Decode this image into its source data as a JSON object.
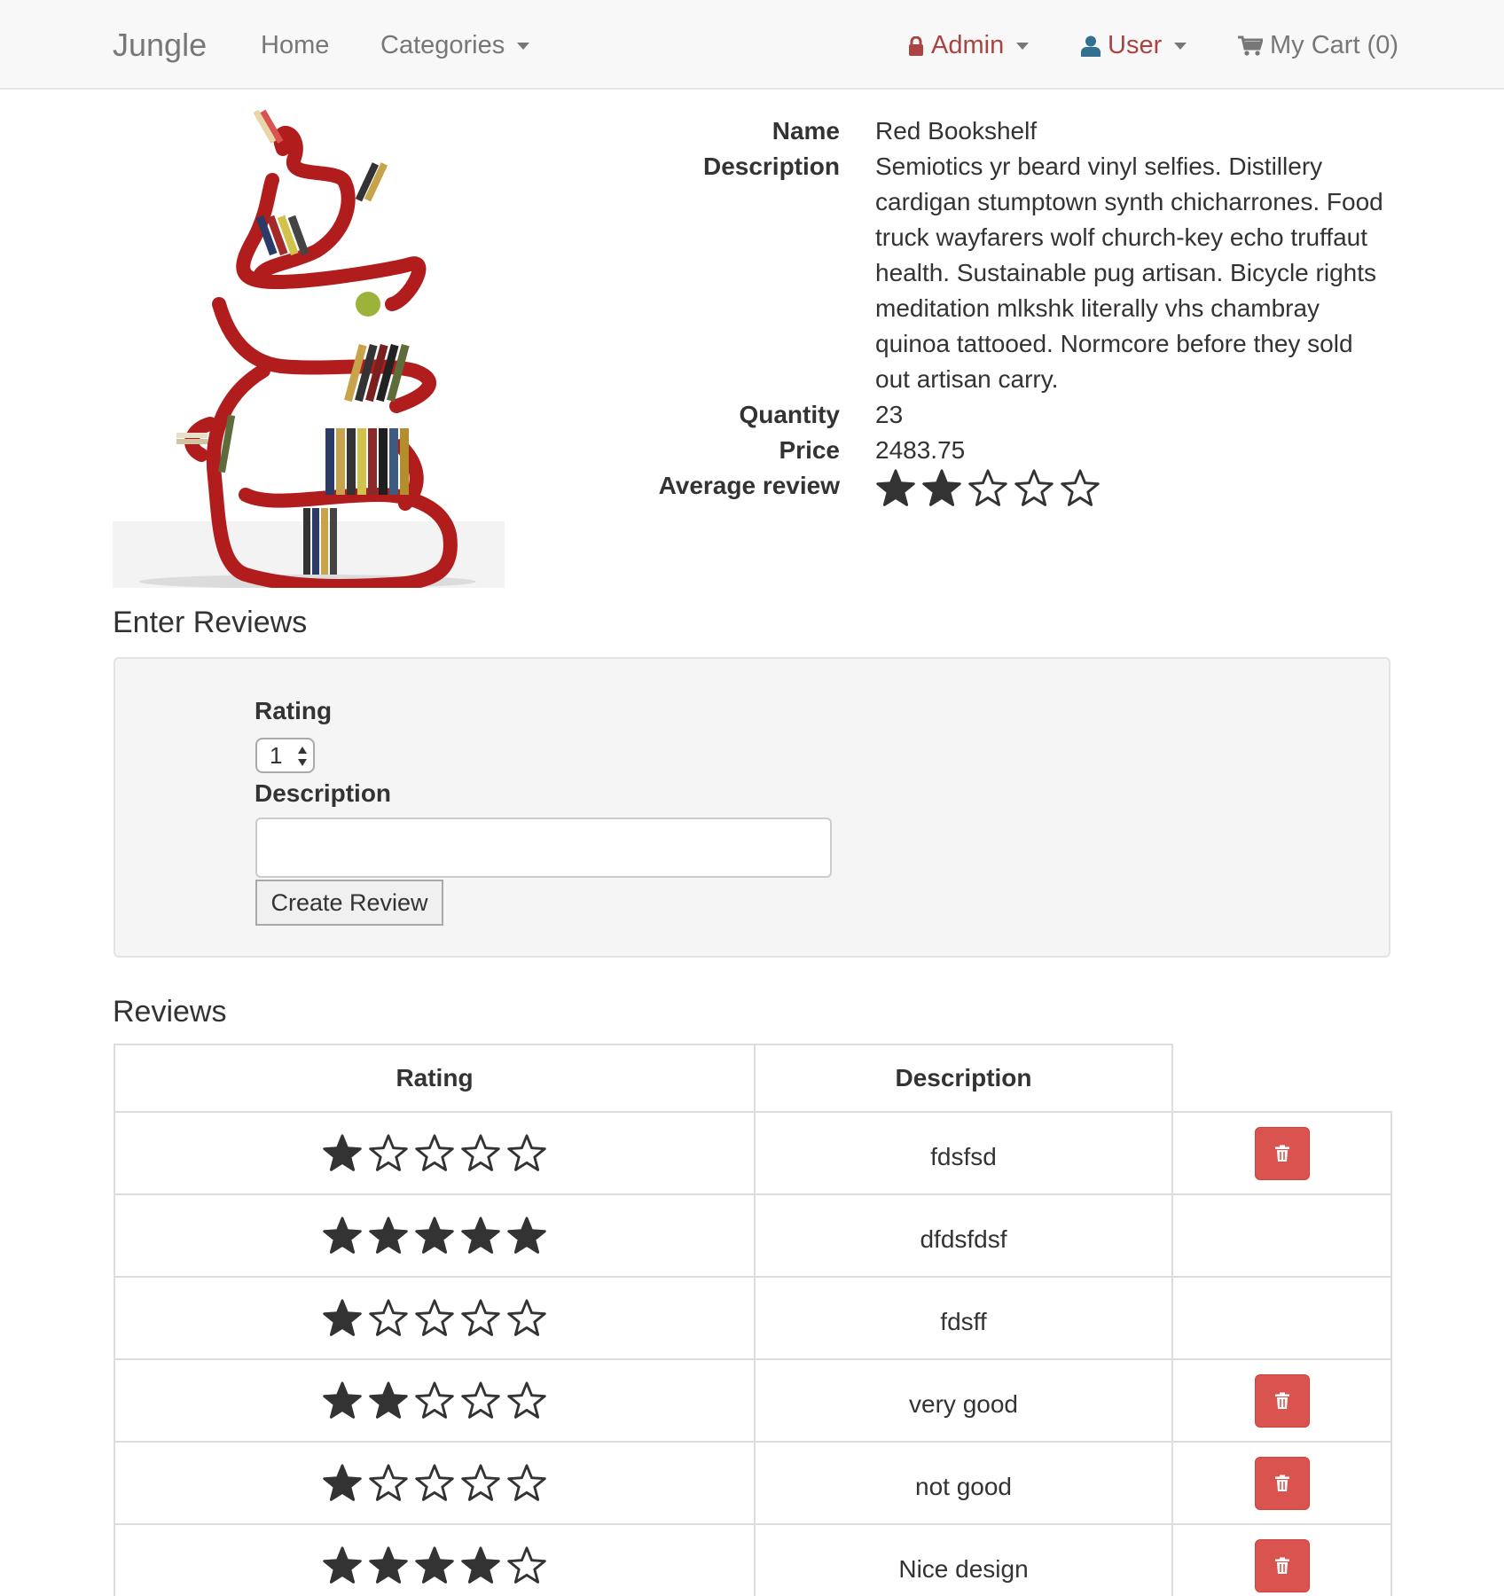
{
  "navbar": {
    "brand": "Jungle",
    "home": "Home",
    "categories": "Categories",
    "admin": "Admin",
    "user": "User",
    "cart": "My Cart (0)"
  },
  "product": {
    "name_label": "Name",
    "name": "Red Bookshelf",
    "description_label": "Description",
    "description": "Semiotics yr beard vinyl selfies. Distillery cardigan stumptown synth chicharrones. Food truck wayfarers wolf church-key echo truffaut health. Sustainable pug artisan. Bicycle rights meditation mlkshk literally vhs chambray quinoa tattooed. Normcore before they sold out artisan carry.",
    "quantity_label": "Quantity",
    "quantity": "23",
    "price_label": "Price",
    "price": "2483.75",
    "average_review_label": "Average review",
    "average_rating": 2
  },
  "enter_reviews": {
    "heading": "Enter Reviews",
    "rating_label": "Rating",
    "rating_value": "1",
    "description_label": "Description",
    "description_value": "",
    "submit_label": "Create Review"
  },
  "reviews": {
    "heading": "Reviews",
    "columns": [
      "Rating",
      "Description"
    ],
    "rows": [
      {
        "rating": 1,
        "description": "fdsfsd",
        "deletable": true
      },
      {
        "rating": 5,
        "description": "dfdsfdsf",
        "deletable": false
      },
      {
        "rating": 1,
        "description": "fdsff",
        "deletable": false
      },
      {
        "rating": 2,
        "description": "very good",
        "deletable": true
      },
      {
        "rating": 1,
        "description": "not good",
        "deletable": true
      },
      {
        "rating": 4,
        "description": "Nice design",
        "deletable": true
      }
    ]
  },
  "icons": {
    "admin": "lock-icon",
    "user": "user-icon",
    "cart": "shopping-cart-icon",
    "delete": "trash-icon",
    "star_filled": "star-filled-icon",
    "star_empty": "star-empty-icon"
  },
  "colors": {
    "danger": "#d9534f",
    "admin_text": "#a94442",
    "user_icon": "#31708f",
    "star": "#333333"
  }
}
